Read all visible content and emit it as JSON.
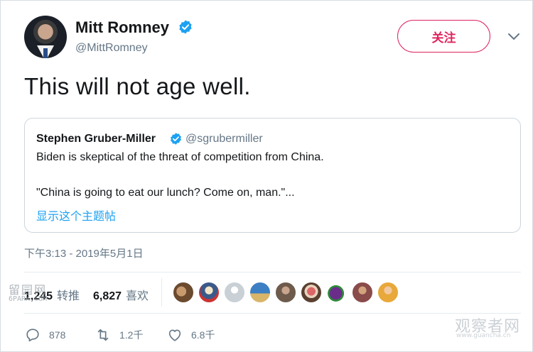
{
  "author": {
    "name": "Mitt Romney",
    "handle": "@MittRomney",
    "verified": true
  },
  "follow_button": {
    "label": "关注"
  },
  "tweet": {
    "text": "This will not age well.",
    "timestamp": "下午3:13 - 2019年5月1日"
  },
  "quoted_tweet": {
    "name": "Stephen Gruber-Miller",
    "handle": "@sgrubermiller",
    "verified": true,
    "line1": "Biden is skeptical of the threat of competition from China.",
    "line2": "\"China is going to eat our lunch? Come on, man.\"...",
    "show_thread": "显示这个主题帖"
  },
  "stats": {
    "retweets_count": "1,245",
    "retweets_label": "转推",
    "likes_count": "6,827",
    "likes_label": "喜欢"
  },
  "actions": {
    "reply_count": "878",
    "retweet_count": "1.2千",
    "like_count": "6.8千"
  },
  "watermarks": {
    "left_line1": "留园网",
    "left_line2": "6PARK.COM",
    "right_line1": "观察者网",
    "right_line2": "www.guancha.cn"
  },
  "colors": {
    "brand_blue": "#1da1f2",
    "follow_red": "#e0245e",
    "muted_gray": "#657786"
  },
  "icons": {
    "verified": "verified-badge-icon",
    "caret": "chevron-down-icon",
    "reply": "reply-icon",
    "retweet": "retweet-icon",
    "like": "heart-icon"
  }
}
